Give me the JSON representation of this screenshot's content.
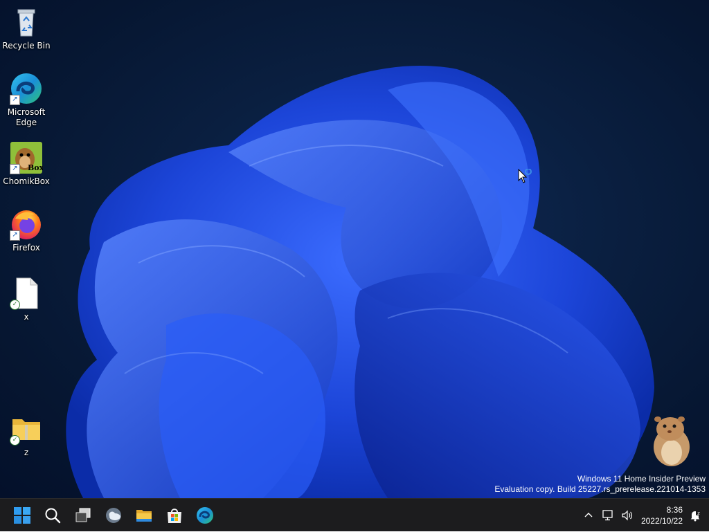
{
  "desktop": {
    "icons": [
      {
        "label": "Recycle Bin",
        "icon": "recycle-bin-icon"
      },
      {
        "label": "Microsoft Edge",
        "icon": "edge-icon",
        "shortcut": true
      },
      {
        "label": "ChomikBox",
        "icon": "chomikbox-icon",
        "shortcut": true,
        "badge": "Box"
      },
      {
        "label": "Firefox",
        "icon": "firefox-icon",
        "shortcut": true
      },
      {
        "label": "x",
        "icon": "file-icon",
        "synced": true
      },
      {
        "label": "z",
        "icon": "folder-icon",
        "synced": true
      }
    ]
  },
  "watermark": {
    "line1": "Windows 11 Home Insider Preview",
    "line2": "Evaluation copy. Build 25227.rs_prerelease.221014-1353"
  },
  "taskbar": {
    "buttons": [
      "start-icon",
      "search-icon",
      "task-view-icon",
      "widgets-icon",
      "file-explorer-icon",
      "microsoft-store-icon",
      "edge-icon"
    ],
    "tray": {
      "icons": [
        "chevron-up-icon",
        "network-icon",
        "volume-icon",
        "notification-icon"
      ],
      "time": "8:36",
      "date": "2022/10/22"
    }
  },
  "colors": {
    "taskbar_bg": "#1c1c1e",
    "wallpaper_bg": "#061631",
    "bloom_blue": "#1f4fe0",
    "start_blue": "#2f9cf0"
  }
}
